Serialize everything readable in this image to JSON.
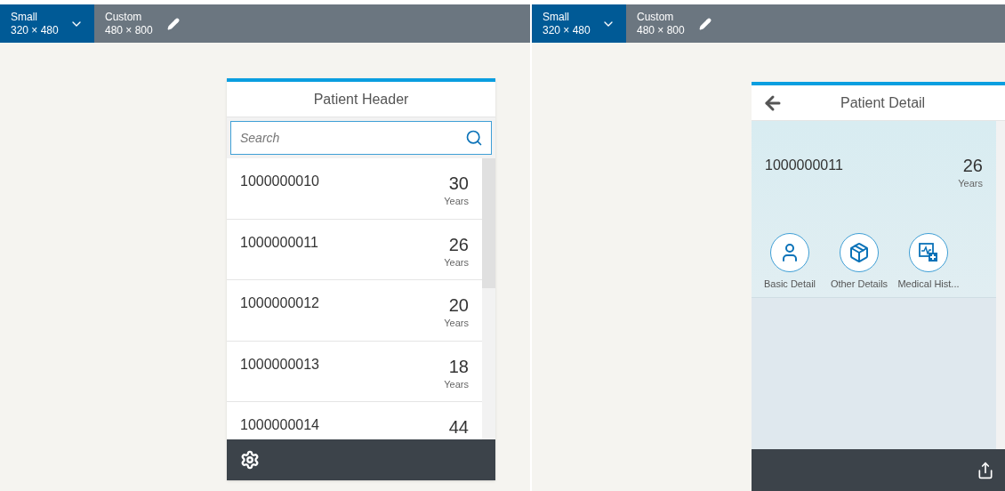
{
  "left_pane": {
    "device_bar": {
      "options": [
        {
          "name": "Small",
          "size": "320 × 480",
          "selected": true
        },
        {
          "name": "Custom",
          "size": "480 × 800",
          "selected": false
        }
      ]
    },
    "list_page": {
      "title": "Patient Header",
      "search": {
        "placeholder": "Search"
      },
      "patients": [
        {
          "id": "1000000010",
          "age": "30",
          "unit": "Years"
        },
        {
          "id": "1000000011",
          "age": "26",
          "unit": "Years"
        },
        {
          "id": "1000000012",
          "age": "20",
          "unit": "Years"
        },
        {
          "id": "1000000013",
          "age": "18",
          "unit": "Years"
        },
        {
          "id": "1000000014",
          "age": "44"
        }
      ]
    }
  },
  "right_pane": {
    "device_bar": {
      "options": [
        {
          "name": "Small",
          "size": "320 × 480",
          "selected": true
        },
        {
          "name": "Custom",
          "size": "480 × 800",
          "selected": false
        }
      ]
    },
    "detail_page": {
      "title": "Patient Detail",
      "patient": {
        "id": "1000000011",
        "age": "26",
        "unit": "Years"
      },
      "actions": [
        {
          "kind": "person",
          "label": "Basic Detail"
        },
        {
          "kind": "box",
          "label": "Other Details"
        },
        {
          "kind": "medical",
          "label": "Medical Hist..."
        }
      ]
    }
  }
}
